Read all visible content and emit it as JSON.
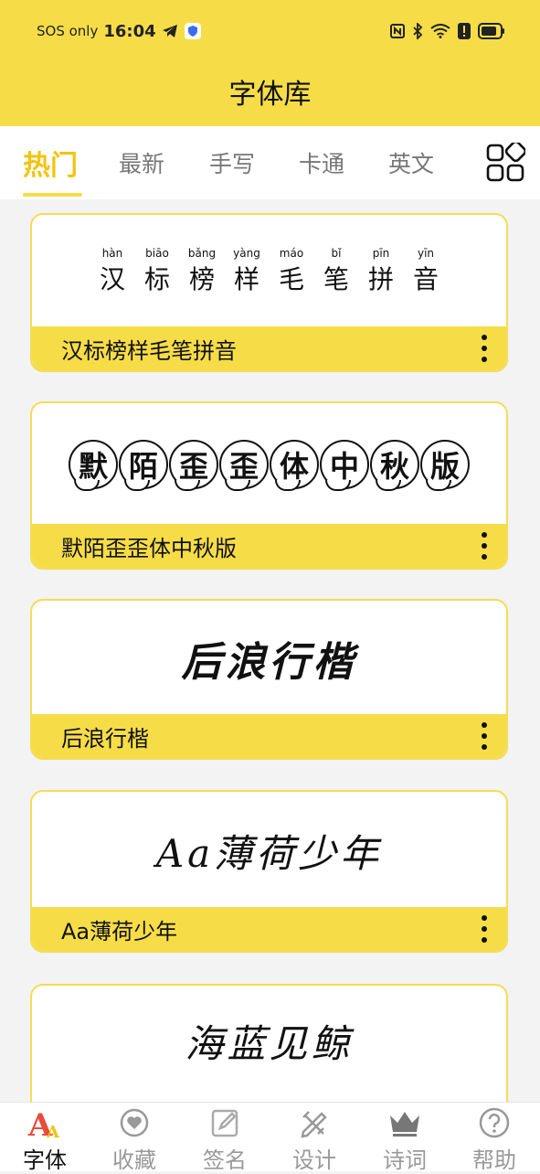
{
  "status_bar": {
    "carrier": "SOS only",
    "time": "16:04"
  },
  "header": {
    "title": "字体库",
    "background": "#f6dd48"
  },
  "tabs": [
    {
      "label": "热门",
      "active": true
    },
    {
      "label": "最新",
      "active": false
    },
    {
      "label": "手写",
      "active": false
    },
    {
      "label": "卡通",
      "active": false
    },
    {
      "label": "英文",
      "active": false
    }
  ],
  "fonts": [
    {
      "name": "汉标榜样毛笔拼音",
      "preview_pinyin": [
        "hàn",
        "biāo",
        "bǎng",
        "yàng",
        "máo",
        "bǐ",
        "pīn",
        "yīn"
      ],
      "preview_chars": [
        "汉",
        "标",
        "榜",
        "样",
        "毛",
        "笔",
        "拼",
        "音"
      ]
    },
    {
      "name": "默陌歪歪体中秋版",
      "preview_chars": [
        "默",
        "陌",
        "歪",
        "歪",
        "体",
        "中",
        "秋",
        "版"
      ]
    },
    {
      "name": "后浪行楷",
      "preview": "后浪行楷"
    },
    {
      "name": "Aa薄荷少年",
      "preview": "Aa薄荷少年"
    },
    {
      "name": "",
      "preview": "海蓝见鲸"
    }
  ],
  "bottom_nav": [
    {
      "label": "字体",
      "icon": "font-icon",
      "active": true
    },
    {
      "label": "收藏",
      "icon": "heart-icon",
      "active": false
    },
    {
      "label": "签名",
      "icon": "edit-icon",
      "active": false
    },
    {
      "label": "设计",
      "icon": "design-icon",
      "active": false
    },
    {
      "label": "诗词",
      "icon": "crown-icon",
      "active": false
    },
    {
      "label": "帮助",
      "icon": "help-icon",
      "active": false
    }
  ],
  "colors": {
    "accent": "#f6dd48",
    "active_tab": "#f1c40f",
    "active_nav_icon": "#e74c3c"
  }
}
